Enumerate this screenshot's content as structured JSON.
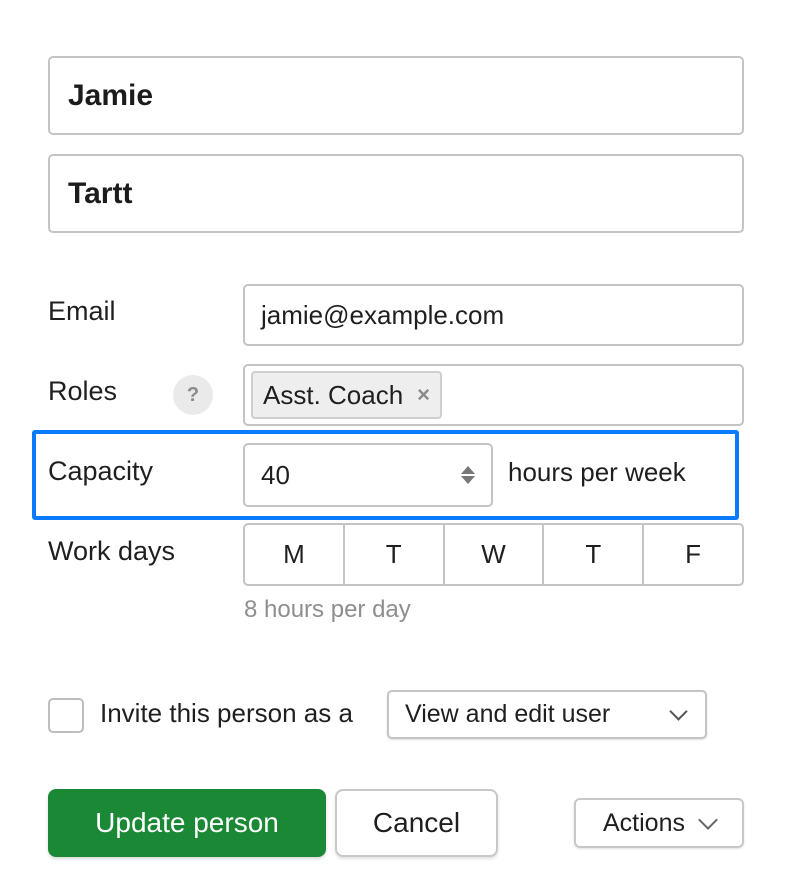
{
  "person": {
    "first_name": "Jamie",
    "last_name": "Tartt"
  },
  "fields": {
    "email_label": "Email",
    "email_value": "jamie@example.com",
    "roles_label": "Roles",
    "roles_help_icon": "?",
    "roles": [
      {
        "label": "Asst. Coach",
        "remove_icon": "×"
      }
    ],
    "capacity_label": "Capacity",
    "capacity_value": "40",
    "capacity_unit": "hours per week",
    "workdays_label": "Work days",
    "workdays": [
      "M",
      "T",
      "W",
      "T",
      "F"
    ],
    "workdays_hint": "8 hours per day"
  },
  "invite": {
    "checked": false,
    "label": "Invite this person as a",
    "selected_option": "View and edit user"
  },
  "actions": {
    "update_label": "Update person",
    "cancel_label": "Cancel",
    "actions_label": "Actions"
  },
  "colors": {
    "primary_green": "#1b8836",
    "highlight_blue": "#0a7bff"
  }
}
